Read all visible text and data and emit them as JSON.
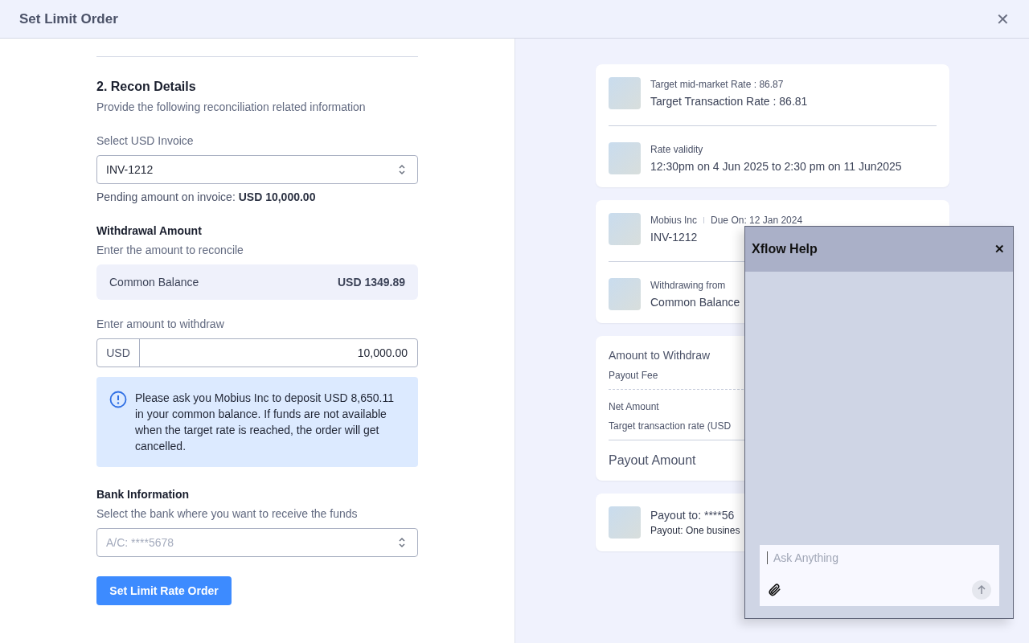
{
  "dialog": {
    "title": "Set Limit Order",
    "close_glyph": "✕"
  },
  "form": {
    "section_title": "2. Recon Details",
    "section_subtitle": "Provide the following reconciliation related information",
    "invoice": {
      "label": "Select USD Invoice",
      "value": "INV-1212",
      "pending_label": "Pending amount on invoice: ",
      "pending_amount": "USD 10,000.00"
    },
    "withdrawal": {
      "title": "Withdrawal Amount",
      "subtitle": "Enter the amount to reconcile",
      "balance_label": "Common Balance",
      "balance_value": "USD 1349.89",
      "amount_label": "Enter amount to withdraw",
      "currency": "USD",
      "amount": "10,000.00"
    },
    "notice": "Please ask you Mobius Inc to deposit USD 8,650.11 in your common balance. If funds are not available when the target rate is reached, the order will get cancelled.",
    "bank": {
      "title": "Bank Information",
      "subtitle": "Select the bank where you want to receive the funds",
      "placeholder": "A/C: ****5678"
    },
    "submit": "Set Limit Rate Order"
  },
  "summary": {
    "rate_card": [
      {
        "small": "Target mid-market Rate : 86.87",
        "large": "Target Transaction Rate : 86.81"
      },
      {
        "small": "Rate validity",
        "large": "12:30pm on 4 Jun 2025 to 2:30 pm on 11 Jun2025"
      }
    ],
    "invoice_card": [
      {
        "small": "Mobius Inc",
        "small_extra": "Due On: 12 Jan 2024",
        "large": "INV-1212"
      },
      {
        "small": "Withdrawing from",
        "large": "Common Balance"
      }
    ],
    "amount_card": {
      "rows": [
        "Amount to Withdraw",
        "Payout Fee"
      ],
      "rows2": [
        "Net Amount",
        "Target transaction rate (USD"
      ],
      "total": "Payout Amount"
    },
    "payout_card": {
      "title": "Payout to: ****56",
      "subtitle": "Payout: One busines"
    }
  },
  "help": {
    "title": "Xflow Help",
    "close_glyph": "✕",
    "placeholder": "Ask Anything"
  }
}
